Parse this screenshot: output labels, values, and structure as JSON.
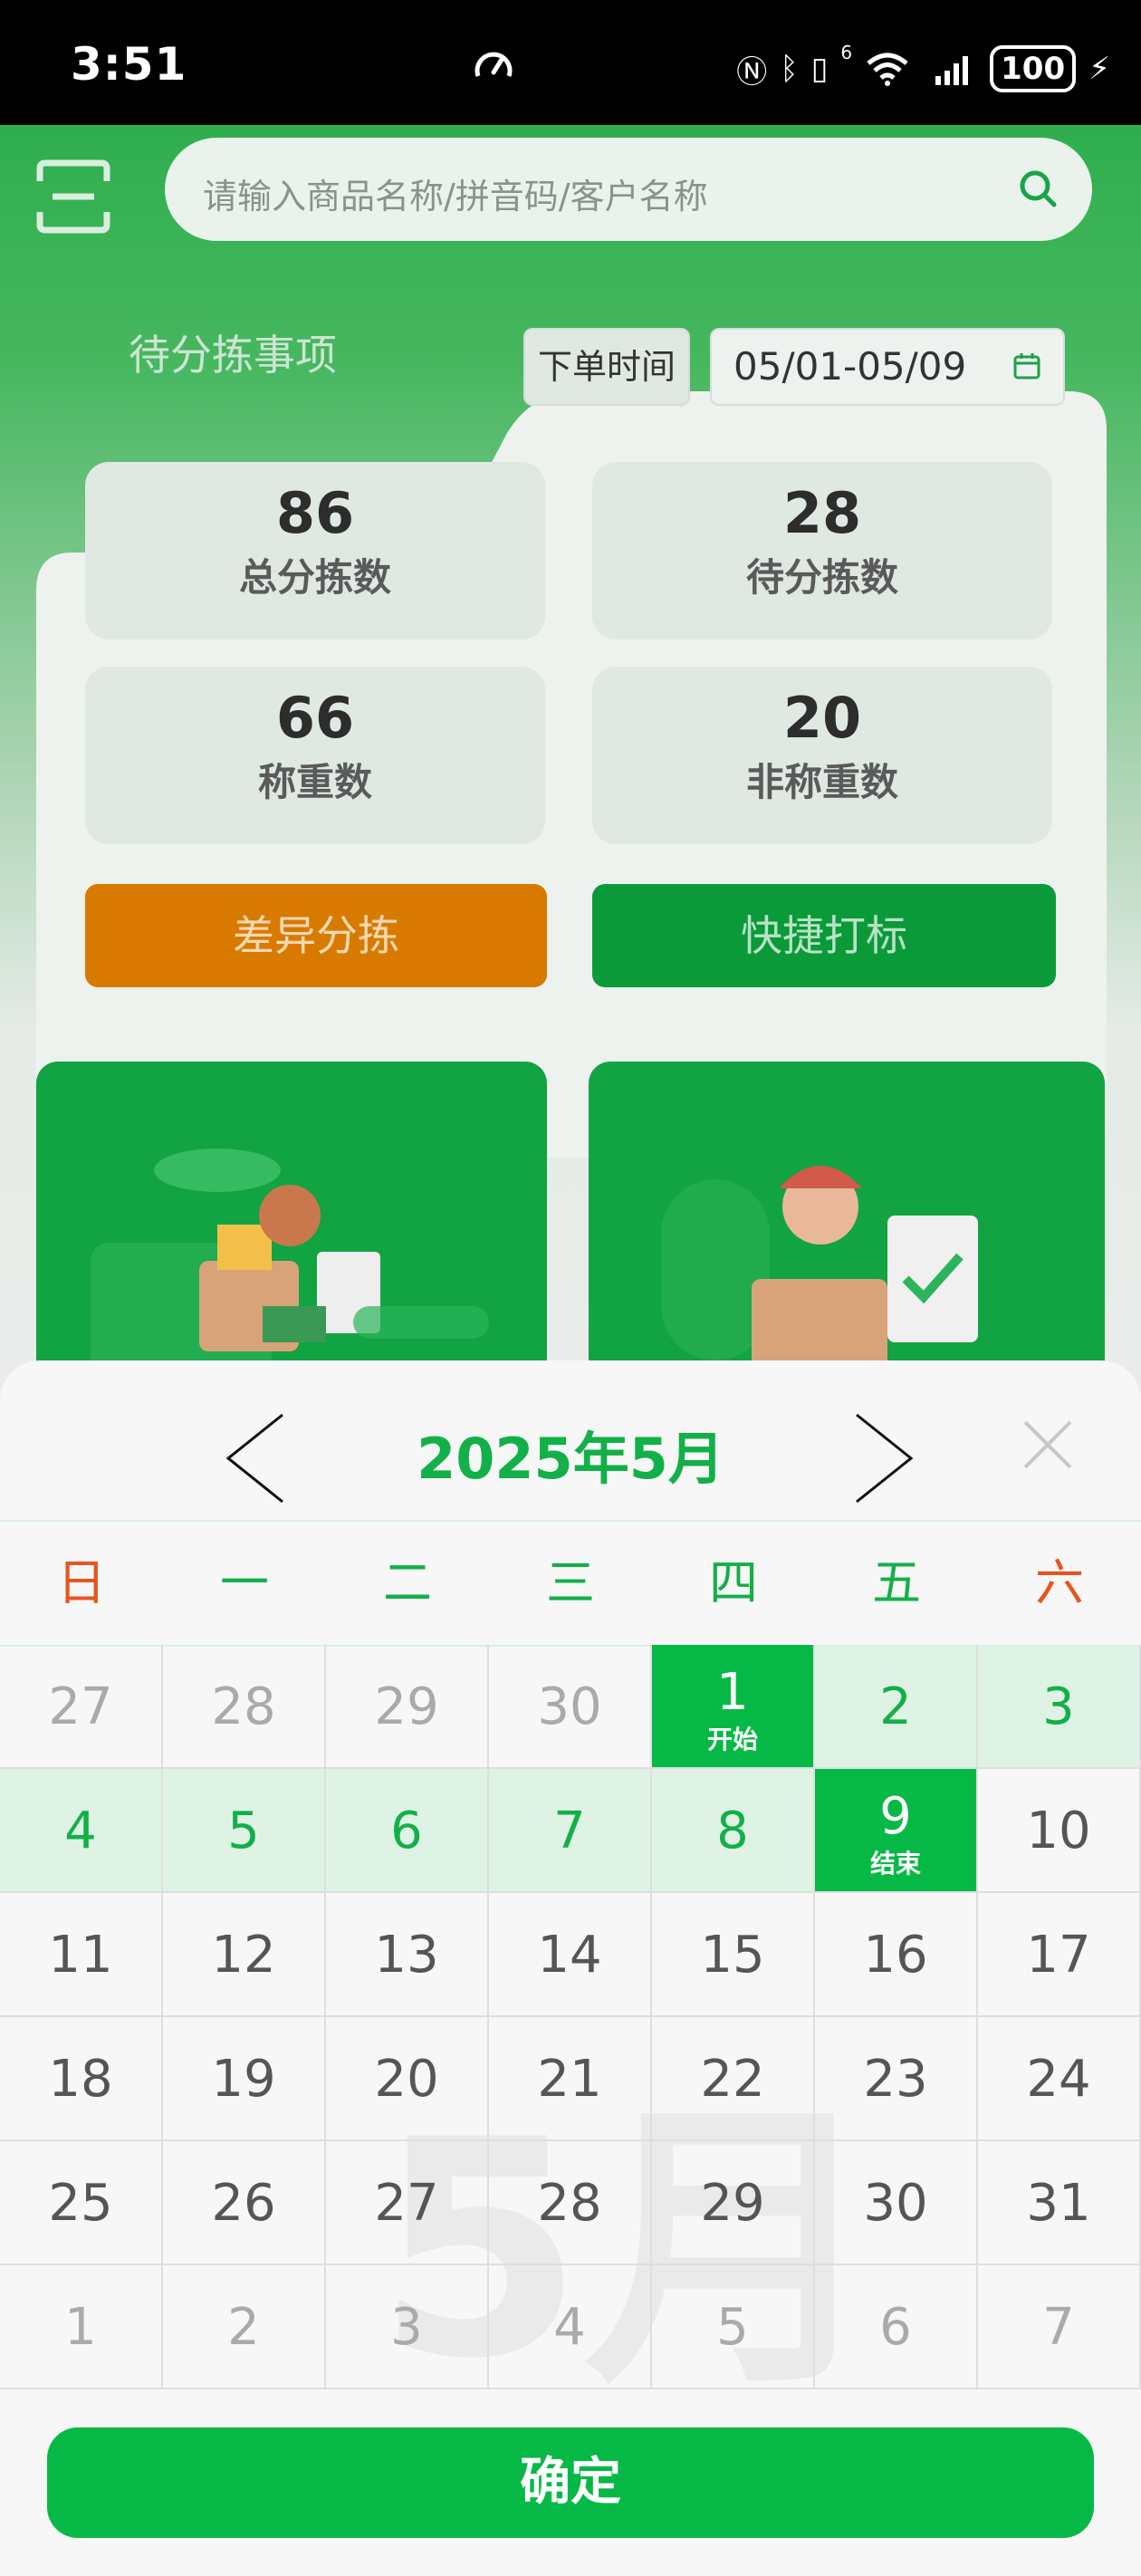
{
  "status_bar": {
    "time": "3:51",
    "battery": "100",
    "network_badge": "6",
    "icons": [
      "speedometer-icon",
      "nfc-icon",
      "bluetooth-icon",
      "vibrate-icon",
      "wifi-icon",
      "signal-icon",
      "charging-icon"
    ]
  },
  "header": {
    "search_placeholder": "请输入商品名称/拼音码/客户名称"
  },
  "pending": {
    "tab_title": "待分拣事项",
    "order_time_label": "下单时间",
    "date_range": "05/01-05/09",
    "stats": [
      {
        "value": "86",
        "label": "总分拣数"
      },
      {
        "value": "28",
        "label": "待分拣数"
      },
      {
        "value": "66",
        "label": "称重数"
      },
      {
        "value": "20",
        "label": "非称重数"
      }
    ],
    "diff_button": "差异分拣",
    "quick_button": "快捷打标"
  },
  "calendar": {
    "title": "2025年5月",
    "watermark": "5月",
    "weekdays": [
      "日",
      "一",
      "二",
      "三",
      "四",
      "五",
      "六"
    ],
    "start_tag": "开始",
    "end_tag": "结束",
    "weeks": [
      [
        "27",
        "28",
        "29",
        "30",
        "1",
        "2",
        "3"
      ],
      [
        "4",
        "5",
        "6",
        "7",
        "8",
        "9",
        "10"
      ],
      [
        "11",
        "12",
        "13",
        "14",
        "15",
        "16",
        "17"
      ],
      [
        "18",
        "19",
        "20",
        "21",
        "22",
        "23",
        "24"
      ],
      [
        "25",
        "26",
        "27",
        "28",
        "29",
        "30",
        "31"
      ],
      [
        "1",
        "2",
        "3",
        "4",
        "5",
        "6",
        "7"
      ]
    ],
    "confirm_label": "确定",
    "colors": {
      "accent": "#06b946",
      "range": "#dff3e5",
      "weekend": "#e8541f"
    }
  }
}
